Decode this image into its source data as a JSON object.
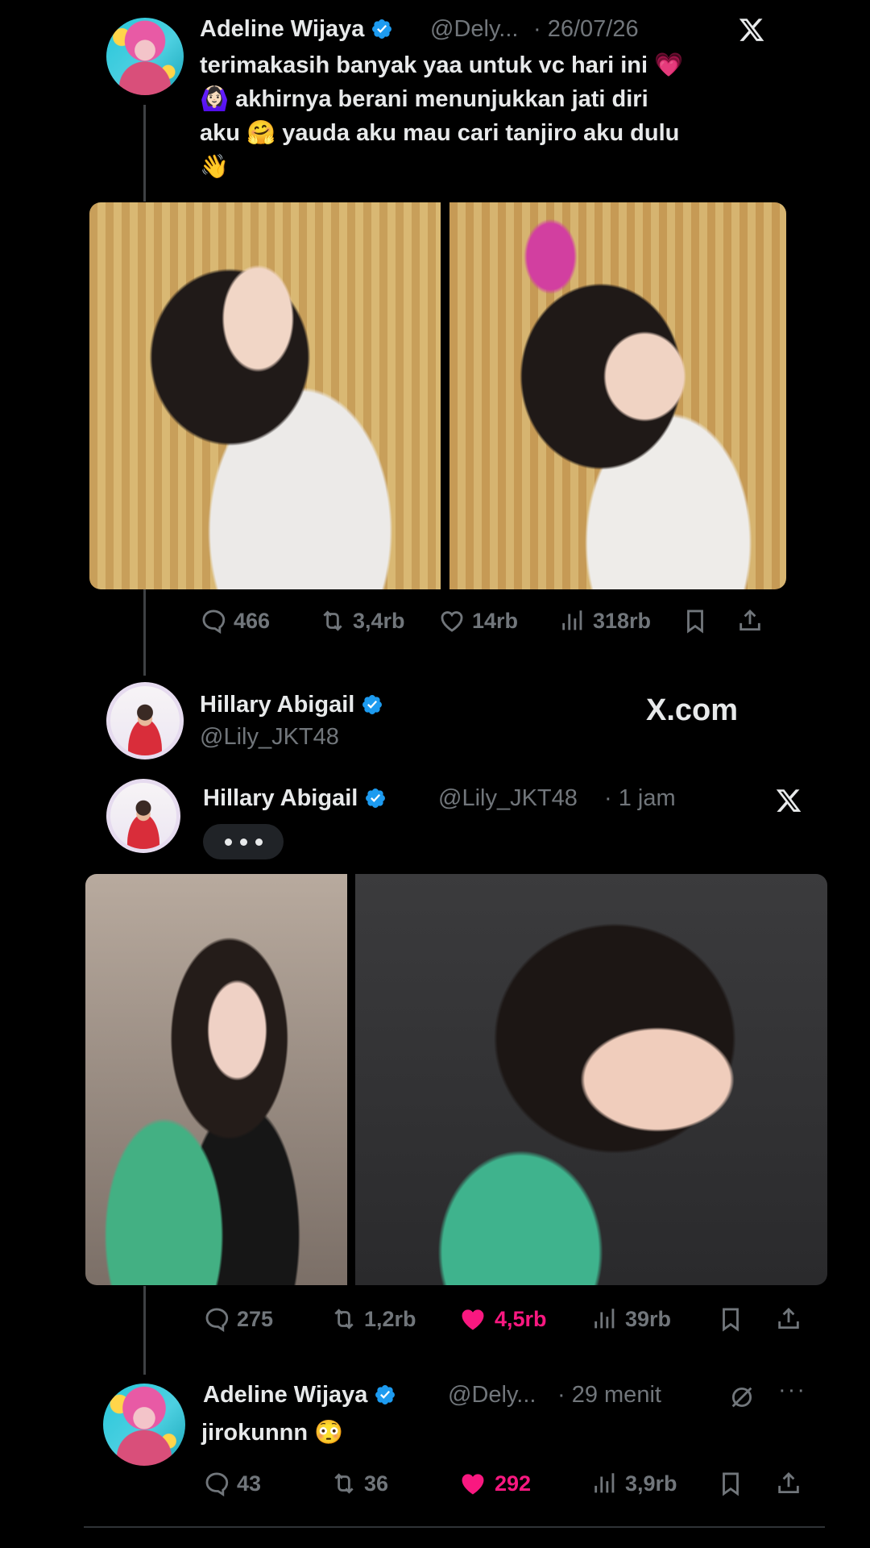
{
  "tweet1": {
    "author": "Adeline Wijaya",
    "handle": "@Dely...",
    "date": "· 26/07/26",
    "line1": "terimakasih banyak yaa untuk vc hari ini 💗",
    "line2": "🙆🏻‍♀️ akhirnya berani menunjukkan jati diri",
    "line3": "aku 🤗 yauda aku mau cari tanjiro aku dulu",
    "line4": "👋",
    "replies": "466",
    "retweets": "3,4rb",
    "likes": "14rb",
    "views": "318rb"
  },
  "quote_header": {
    "author": "Hillary Abigail",
    "handle": "@Lily_JKT48",
    "site": "X.com"
  },
  "tweet2": {
    "author": "Hillary Abigail",
    "handle": "@Lily_JKT48",
    "time": "· 1 jam",
    "replies": "275",
    "retweets": "1,2rb",
    "likes": "4,5rb",
    "views": "39rb"
  },
  "tweet3": {
    "author": "Adeline Wijaya",
    "handle": "@Dely...",
    "time": "· 29 menit",
    "text": "jirokunnn 😳",
    "replies": "43",
    "retweets": "36",
    "likes": "292",
    "views": "3,9rb"
  },
  "colors": {
    "background": "#000000",
    "text": "#e7e9ea",
    "muted": "#71767b",
    "verified": "#1d9bf0",
    "like": "#f91880"
  },
  "icons": {
    "reply": "reply-icon",
    "retweet": "retweet-icon",
    "like": "heart-icon",
    "views": "views-icon",
    "bookmark": "bookmark-icon",
    "share": "share-icon",
    "x_logo": "x-logo-icon",
    "verified": "verified-badge-icon",
    "grok": "grok-icon",
    "more": "more-icon"
  }
}
